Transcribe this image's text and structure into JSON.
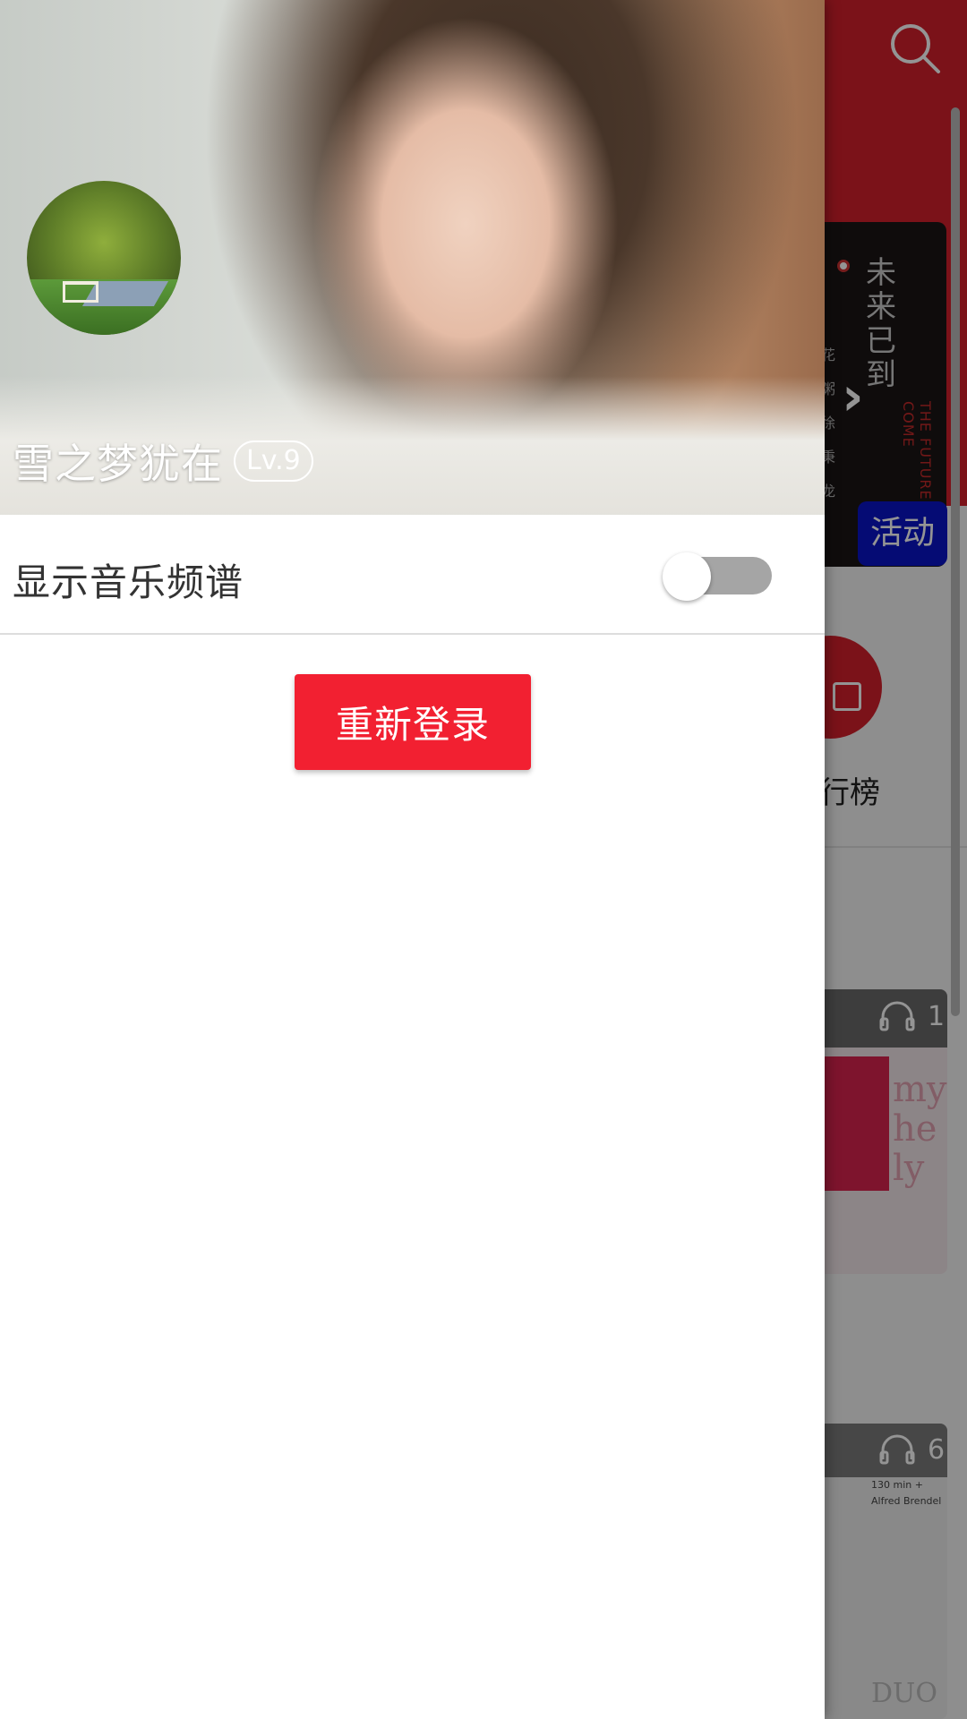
{
  "drawer": {
    "profile": {
      "username": "雪之梦犹在",
      "level": "Lv.9"
    },
    "settings": {
      "spectrum_label": "显示音乐频谱",
      "spectrum_enabled": false
    },
    "relogin_label": "重新登录"
  },
  "background": {
    "banner_text": "未来已到",
    "banner_side_text": "花粥 徐秉龙",
    "banner_subtext": "THE FUTURE HAS COME",
    "activity_label": "活动",
    "rank_label": "行榜",
    "playcount_1": "1",
    "playcount_2": "6",
    "card2_text": "130 min + Alfred Brendel",
    "card2_logo": "DUO"
  },
  "colors": {
    "header_red": "#d4202c",
    "button_red": "#f22031",
    "toggle_off": "#a5a5a5",
    "activity_blue": "#0a14c8"
  }
}
